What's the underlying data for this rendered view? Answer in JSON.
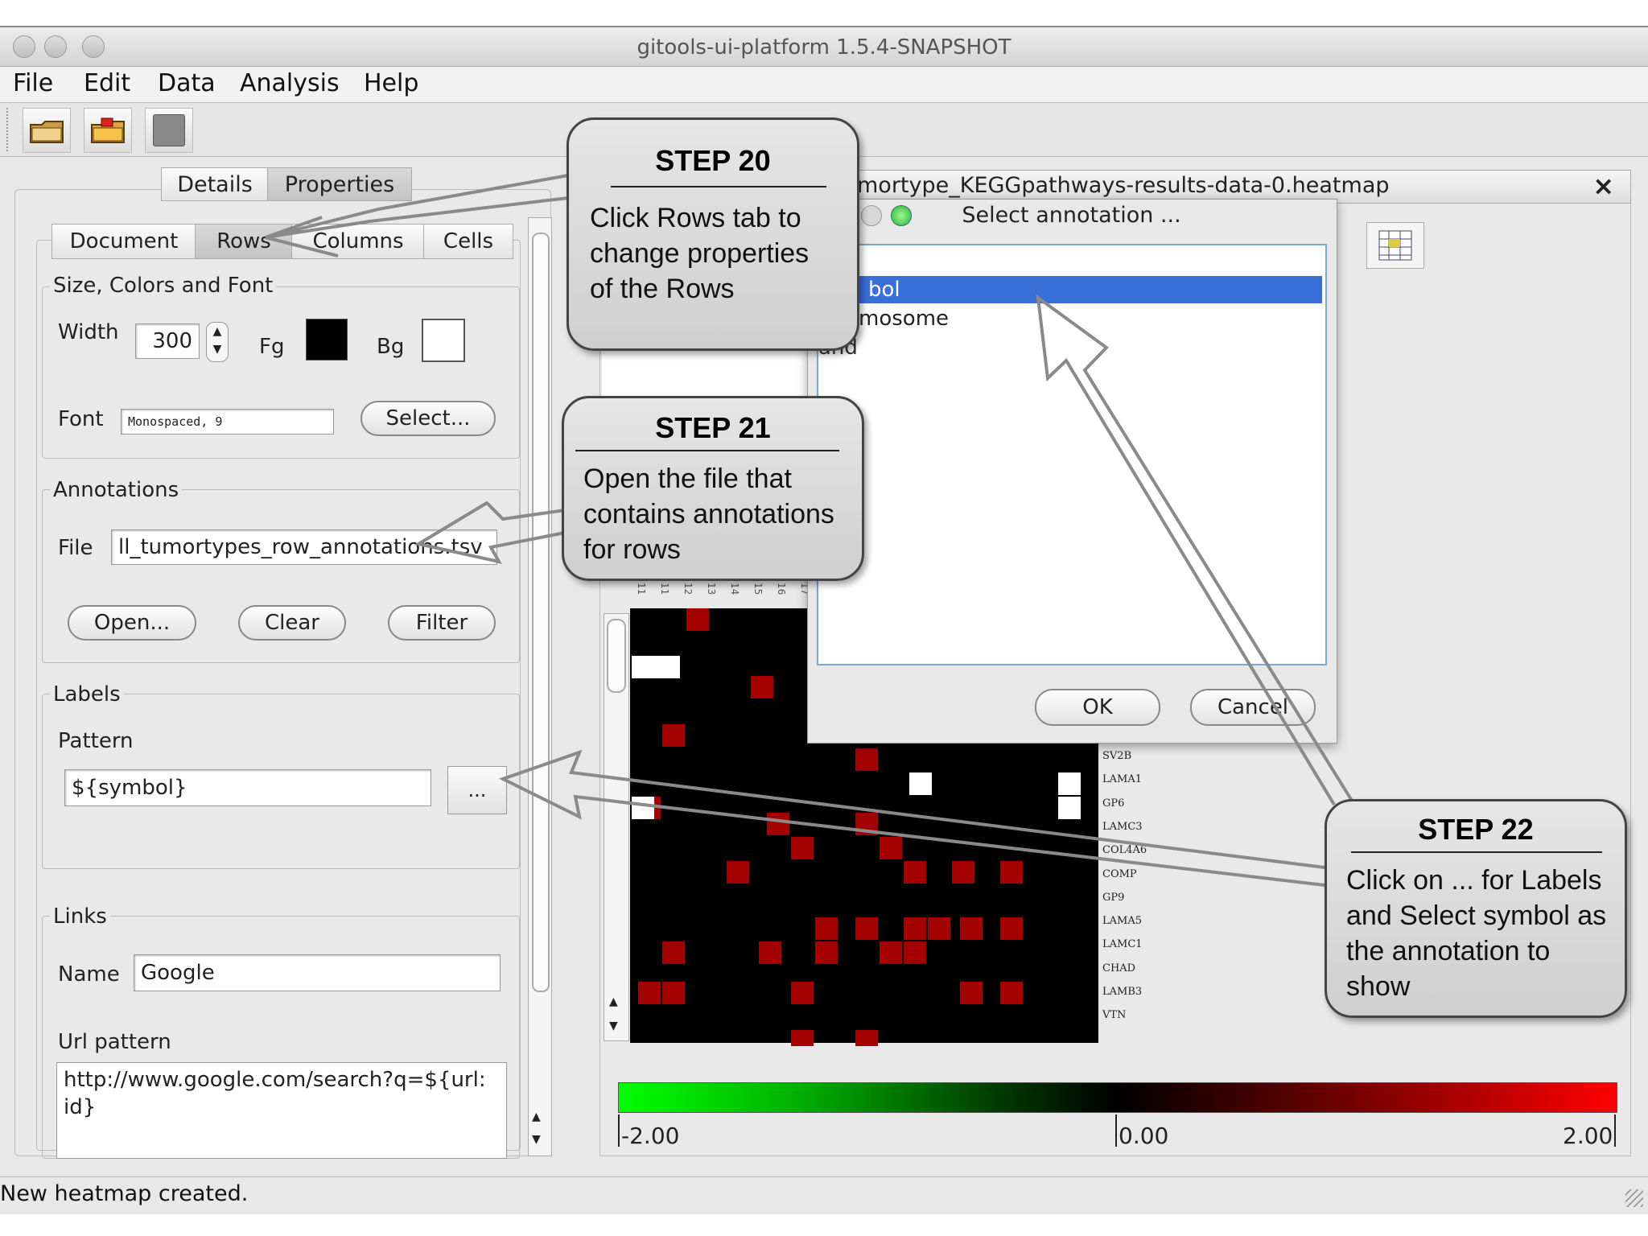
{
  "window": {
    "title": "gitools-ui-platform 1.5.4-SNAPSHOT"
  },
  "menu": [
    "File",
    "Edit",
    "Data",
    "Analysis",
    "Help"
  ],
  "toolbar": {
    "icons": [
      "open-folder-icon",
      "open-file-icon",
      "save-icon"
    ]
  },
  "panel": {
    "tabs": [
      "Details",
      "Properties"
    ],
    "subtabs": [
      "Document",
      "Rows",
      "Columns",
      "Cells"
    ],
    "size_group": {
      "title": "Size, Colors and Font",
      "width_label": "Width",
      "width_value": "300",
      "fg_label": "Fg",
      "bg_label": "Bg",
      "fg_color": "#000000",
      "bg_color": "#ffffff",
      "font_label": "Font",
      "font_value": "Monospaced, 9",
      "select_label": "Select..."
    },
    "annotations": {
      "title": "Annotations",
      "file_label": "File",
      "file_value": "ll_tumortypes_row_annotations.tsv",
      "open_label": "Open...",
      "clear_label": "Clear",
      "filter_label": "Filter"
    },
    "labels": {
      "title": "Labels",
      "pattern_label": "Pattern",
      "pattern_value": "${symbol}",
      "more_label": "..."
    },
    "links": {
      "title": "Links",
      "name_label": "Name",
      "name_value": "Google",
      "url_label": "Url pattern",
      "url_line1": "http://www.google.com/search?q=${url:",
      "url_line2": "id}"
    }
  },
  "document_tab": {
    "title": "mortype_KEGGpathways-results-data-0.heatmap",
    "close": "×"
  },
  "dialog": {
    "title": "Select annotation ...",
    "items": [
      "bol",
      "mosome",
      "and"
    ],
    "ok_label": "OK",
    "cancel_label": "Cancel"
  },
  "heatmap": {
    "row_labels": [
      "SV2B",
      "LAMA1",
      "GP6",
      "LAMC3",
      "COL4A6",
      "COMP",
      "GP9",
      "LAMA5",
      "LAMC1",
      "CHAD",
      "LAMB3",
      "VTN"
    ],
    "col_labels": [
      "11",
      "11",
      "12",
      "13",
      "14",
      "15",
      "16",
      "17"
    ],
    "scale": {
      "min": "-2.00",
      "mid": "0.00",
      "max": "2.00"
    }
  },
  "callouts": {
    "step20": {
      "title": "STEP 20",
      "lines": [
        "Click Rows tab to",
        "change properties",
        "of the Rows"
      ]
    },
    "step21": {
      "title": "STEP 21",
      "lines": [
        "Open the file that",
        "contains annotations",
        "for rows"
      ]
    },
    "step22": {
      "title": "STEP 22",
      "lines": [
        "Click on ... for Labels",
        "and Select symbol as",
        "the annotation to",
        "show"
      ]
    }
  },
  "status": "New heatmap created."
}
